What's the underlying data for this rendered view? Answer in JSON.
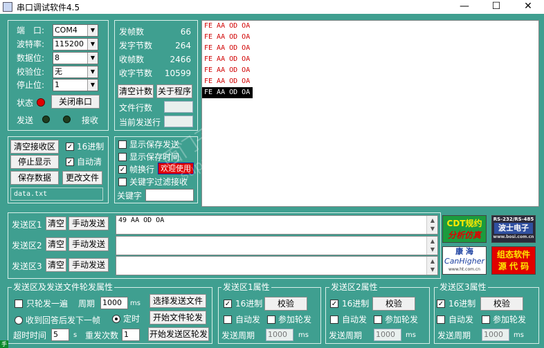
{
  "window": {
    "title": "串口调试软件4.5",
    "minimize_icon": "minimize-icon",
    "maximize_icon": "maximize-icon",
    "close_icon": "close-icon"
  },
  "port_settings": {
    "port_label": "端　口:",
    "port_value": "COM4",
    "baud_label": "波特率:",
    "baud_value": "115200",
    "databits_label": "数据位:",
    "databits_value": "8",
    "parity_label": "校验位:",
    "parity_value": "无",
    "stopbits_label": "停止位:",
    "stopbits_value": "1",
    "status_label": "状态",
    "status_color": "#e00000",
    "close_port_label": "关闭串口",
    "send_label": "发送",
    "recv_label": "接收"
  },
  "counters": {
    "tx_frames_label": "发帧数",
    "tx_frames": "66",
    "tx_bytes_label": "发字节数",
    "tx_bytes": "264",
    "rx_frames_label": "收帧数",
    "rx_frames": "2466",
    "rx_bytes_label": "收字节数",
    "rx_bytes": "10599",
    "clear_count_label": "清空计数",
    "about_label": "关于程序",
    "file_lines_label": "文件行数",
    "current_line_label": "当前发送行"
  },
  "recv_controls": {
    "clear_recv_label": "清空接收区",
    "hex_label": "16进制",
    "hex_checked": true,
    "stop_display_label": "停止显示",
    "auto_clear_label": "自动清",
    "auto_clear_checked": true,
    "save_data_label": "保存数据",
    "change_file_label": "更改文件",
    "file_name": "data.txt"
  },
  "display_options": {
    "show_save_send_label": "显示保存发送",
    "show_save_time_label": "显示保存时间",
    "frame_newline_label": "帧换行",
    "frame_newline_checked": true,
    "welcome_label": "欢迎使用",
    "keyword_filter_label": "关键字过滤接收",
    "keyword_label": "关键字"
  },
  "recv_lines": [
    "FE AA OD OA",
    "FE AA OD OA",
    "FE AA OD OA",
    "FE AA OD OA",
    "FE AA OD OA",
    "FE AA OD OA",
    "FE AA OD OA"
  ],
  "send_areas": [
    {
      "label": "发送区1",
      "clear": "清空",
      "manual": "手动发送",
      "content": "49 AA OD OA"
    },
    {
      "label": "发送区2",
      "clear": "清空",
      "manual": "手动发送",
      "content": ""
    },
    {
      "label": "发送区3",
      "clear": "清空",
      "manual": "手动发送",
      "content": ""
    }
  ],
  "ads": {
    "cdt_line1": "CDT规约",
    "cdt_line2": "分析仿真",
    "bosi_top": "RS-232/RS-485",
    "bosi_mid": "波士电子",
    "bosi_url": "www.bosi.com.cn",
    "kanghai_line1": "康 海",
    "kanghai_line2": "CanHigher",
    "kanghai_url": "www.ht.com.cn",
    "config_line1": "组态软件",
    "config_line2": "源 代 码"
  },
  "file_send": {
    "title": "发送区及发送文件轮发属性",
    "send_once_label": "只轮发一遍",
    "period_label": "周期",
    "period_value": "1000",
    "period_unit": "ms",
    "select_file_label": "选择发送文件",
    "wait_reply_label": "收到回答后发下一帧",
    "timed_label": "定时",
    "start_file_poll_label": "开始文件轮发",
    "timeout_label": "超时时间",
    "timeout_value": "5",
    "timeout_unit": "s",
    "resend_label": "重发次数",
    "resend_value": "1",
    "start_area_poll_label": "开始发送区轮发"
  },
  "area_props": [
    {
      "title": "发送区1属性",
      "hex_label": "16进制",
      "verify_label": "校验",
      "auto_label": "自动发",
      "join_label": "参加轮发",
      "period_label": "发送周期",
      "period_value": "1000",
      "unit": "ms"
    },
    {
      "title": "发送区2属性",
      "hex_label": "16进制",
      "verify_label": "校验",
      "auto_label": "自动发",
      "join_label": "参加轮发",
      "period_label": "发送周期",
      "period_value": "1000",
      "unit": "ms"
    },
    {
      "title": "发送区3属性",
      "hex_label": "16进制",
      "verify_label": "校验",
      "auto_label": "自动发",
      "join_label": "参加轮发",
      "period_label": "发送周期",
      "period_value": "1000",
      "unit": "ms"
    }
  ],
  "watermark": {
    "line1": "西门子工业　技术论坛",
    "line2": "support.industry.siemens.com/cs"
  },
  "bottom_icon": "手"
}
